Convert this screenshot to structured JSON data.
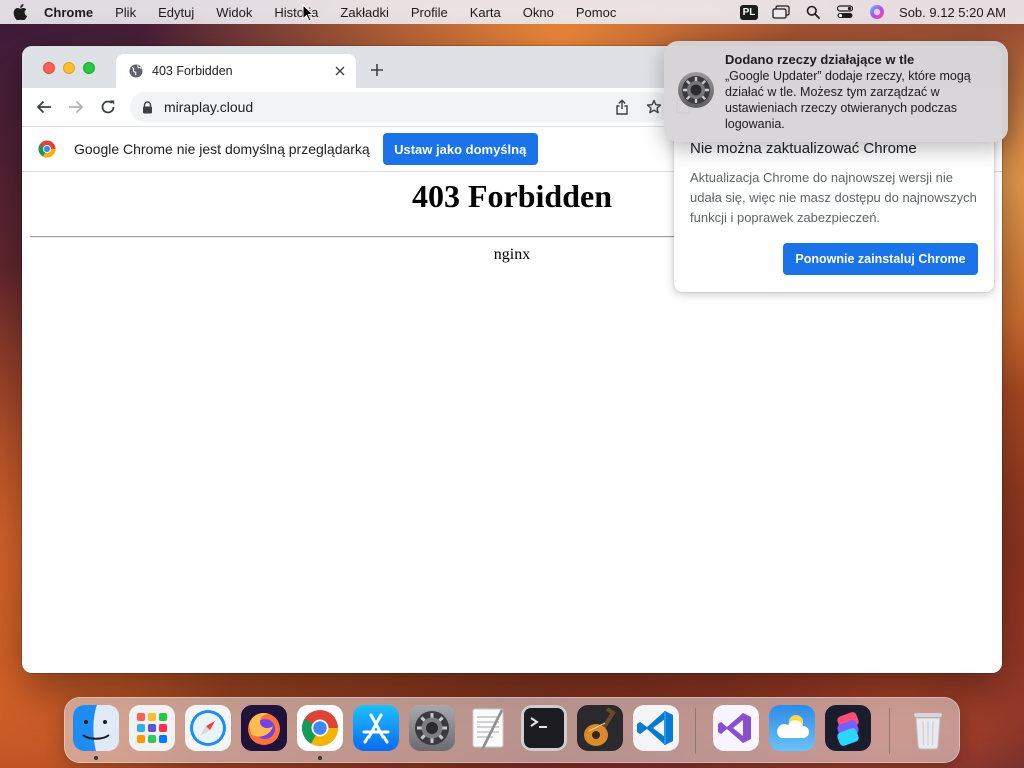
{
  "menubar": {
    "app_name": "Chrome",
    "items": [
      "Plik",
      "Edytuj",
      "Widok",
      "Historia",
      "Zakładki",
      "Profile",
      "Karta",
      "Okno",
      "Pomoc"
    ],
    "input_source": "PL",
    "clock": "Sob. 9.12  5:20 AM"
  },
  "browser": {
    "tab_title": "403 Forbidden",
    "url": "miraplay.cloud",
    "infobar": {
      "message": "Google Chrome nie jest domyślną przeglądarką",
      "button_label": "Ustaw jako domyślną"
    }
  },
  "page": {
    "heading": "403 Forbidden",
    "server": "nginx"
  },
  "update_bubble": {
    "title": "Nie można zaktualizować Chrome",
    "body": "Aktualizacja Chrome do najnowszej wersji nie udała się, więc nie masz dostępu do najnowszych funkcji i poprawek zabezpieczeń.",
    "button_label": "Ponownie zainstaluj Chrome"
  },
  "notification": {
    "title": "Dodano rzeczy działające w tle",
    "body": "„Google Updater” dodaje rzeczy, które mogą działać w tle. Możesz tym zarządzać w ustawieniach rzeczy otwieranych podczas logowania."
  },
  "dock": {
    "apps": [
      "finder-icon",
      "launchpad-icon",
      "safari-icon",
      "firefox-icon",
      "chrome-icon",
      "app-store-icon",
      "system-settings-icon",
      "textedit-icon",
      "terminal-icon",
      "garageband-icon",
      "vscode-icon",
      "visual-studio-icon",
      "weather-icon",
      "shortcuts-icon",
      "trash-icon"
    ],
    "running": [
      "finder-icon",
      "chrome-icon"
    ]
  },
  "colors": {
    "accent": "#1a73e8",
    "tabstrip": "#dee1e6"
  }
}
